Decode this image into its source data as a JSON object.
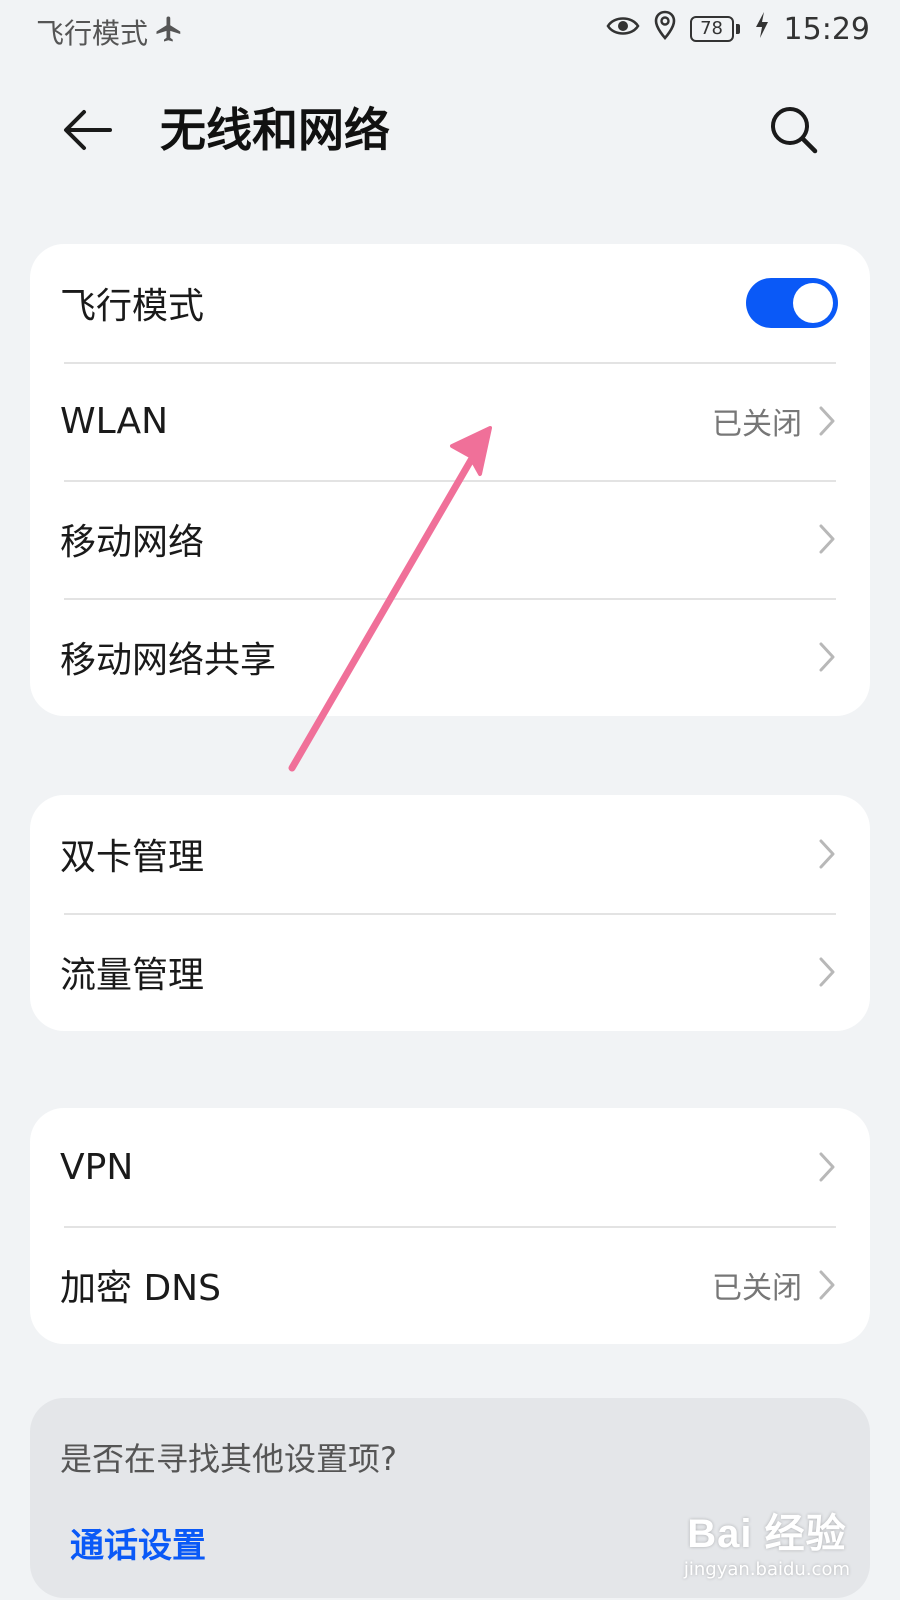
{
  "status_bar": {
    "left_text": "飞行模式",
    "airplane_icon": "airplane-icon",
    "eye_icon": "eye-icon",
    "location_icon": "location-icon",
    "battery_level": "78",
    "charging_icon": "charging-bolt-icon",
    "time": "15:29"
  },
  "header": {
    "back_icon": "arrow-left-icon",
    "title": "无线和网络",
    "search_icon": "search-icon"
  },
  "group1": {
    "items": [
      {
        "label": "飞行模式",
        "type": "toggle",
        "toggle_on": true
      },
      {
        "label": "WLAN",
        "value": "已关闭"
      },
      {
        "label": "移动网络",
        "value": ""
      },
      {
        "label": "移动网络共享",
        "value": ""
      }
    ]
  },
  "group2": {
    "items": [
      {
        "label": "双卡管理",
        "value": ""
      },
      {
        "label": "流量管理",
        "value": ""
      }
    ]
  },
  "group3": {
    "items": [
      {
        "label": "VPN",
        "value": ""
      },
      {
        "label": "加密 DNS",
        "value": "已关闭"
      }
    ]
  },
  "suggestion": {
    "question": "是否在寻找其他设置项?",
    "link": "通话设置"
  },
  "watermark": {
    "logo_text": "Bai 经验",
    "url": "jingyan.baidu.com"
  },
  "colors": {
    "accent": "#0a59f7",
    "background": "#f1f3f5",
    "card": "#ffffff",
    "annotation_arrow": "#f07099"
  }
}
